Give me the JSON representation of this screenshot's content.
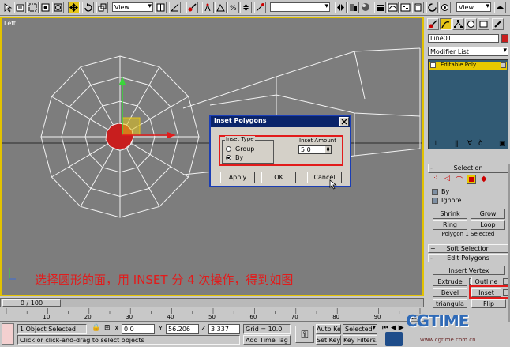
{
  "toolbar": {
    "view_select_1": "View",
    "view_select_2": "View"
  },
  "viewport": {
    "label": "Left",
    "caption": "选择圆形的面，用 INSET 分 4 次操作，得到如图"
  },
  "dialog": {
    "title": "Inset Polygons",
    "group_label": "Inset Type",
    "option_group": "Group",
    "option_by": "By",
    "amount_label": "Inset Amount",
    "amount_value": "5.0",
    "apply": "Apply",
    "ok": "OK",
    "cancel": "Cancel"
  },
  "command_panel": {
    "object_name": "Line01",
    "modifier_list": "Modifier List",
    "stack_item": "Editable Poly",
    "selection_header": "Selection",
    "by_label": "By",
    "ignore_label": "Ignore",
    "shrink": "Shrink",
    "grow": "Grow",
    "ring": "Ring",
    "loop": "Loop",
    "selection_status": "Polygon 1 Selected",
    "soft_selection": "Soft Selection",
    "edit_polygons": "Edit Polygons",
    "insert_vertex": "Insert Vertex",
    "extrude": "Extrude",
    "outline": "Outline",
    "bevel": "Bevel",
    "inset": "Inset",
    "triangulate": "triangula",
    "flip": "Flip",
    "plus": "+",
    "minus": "-"
  },
  "timeline": {
    "frame": "0 / 100",
    "ticks": [
      "10",
      "20",
      "30",
      "40",
      "50",
      "60",
      "70",
      "80",
      "90",
      "100"
    ]
  },
  "status": {
    "objects_selected": "1 Object Selected",
    "prompt": "Click or click-and-drag to select objects",
    "x_label": "X",
    "x_value": "0.0",
    "y_label": "Y",
    "y_value": "56.206",
    "z_label": "Z",
    "z_value": "3.337",
    "grid": "Grid = 10.0",
    "add_time_tag": "Add Time Tag",
    "auto_key": "Auto Key",
    "selected": "Selected",
    "set_key": "Set Key",
    "key_filters": "Key Filters..."
  },
  "watermark": {
    "logo": "CGTIME",
    "url": "www.cgtime.com.cn"
  },
  "colors": {
    "viewport_bg": "#7d7d7d",
    "highlight_red": "#e21b1b",
    "selected_face": "#c81e1e",
    "dialog_border": "#1a3db5",
    "stack_selected": "#e8c800"
  }
}
